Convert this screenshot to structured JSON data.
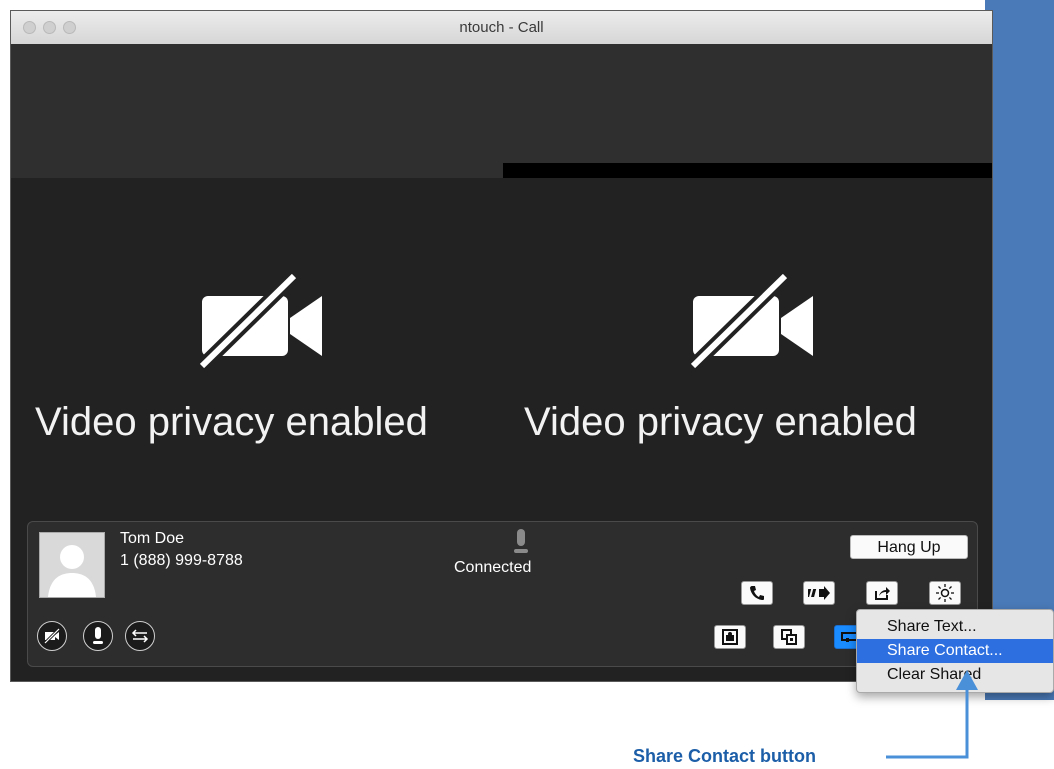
{
  "window": {
    "title": "ntouch - Call"
  },
  "video": {
    "left_text": "Video privacy enabled",
    "right_text": "Video privacy enabled"
  },
  "contact": {
    "name": "Tom Doe",
    "number": "1 (888) 999-8788",
    "status": "Connected"
  },
  "controls": {
    "hang_up_label": "Hang Up"
  },
  "share_menu": {
    "items": [
      {
        "label": "Share Text...",
        "selected": false
      },
      {
        "label": "Share Contact...",
        "selected": true
      },
      {
        "label": "Clear Shared",
        "selected": false
      }
    ]
  },
  "annotation": {
    "label": "Share Contact button",
    "color": "#1c5ea8"
  },
  "colors": {
    "accent": "#1a8cff",
    "menu_selection": "#2d6fe0",
    "desktop": "#4a7ab8"
  }
}
